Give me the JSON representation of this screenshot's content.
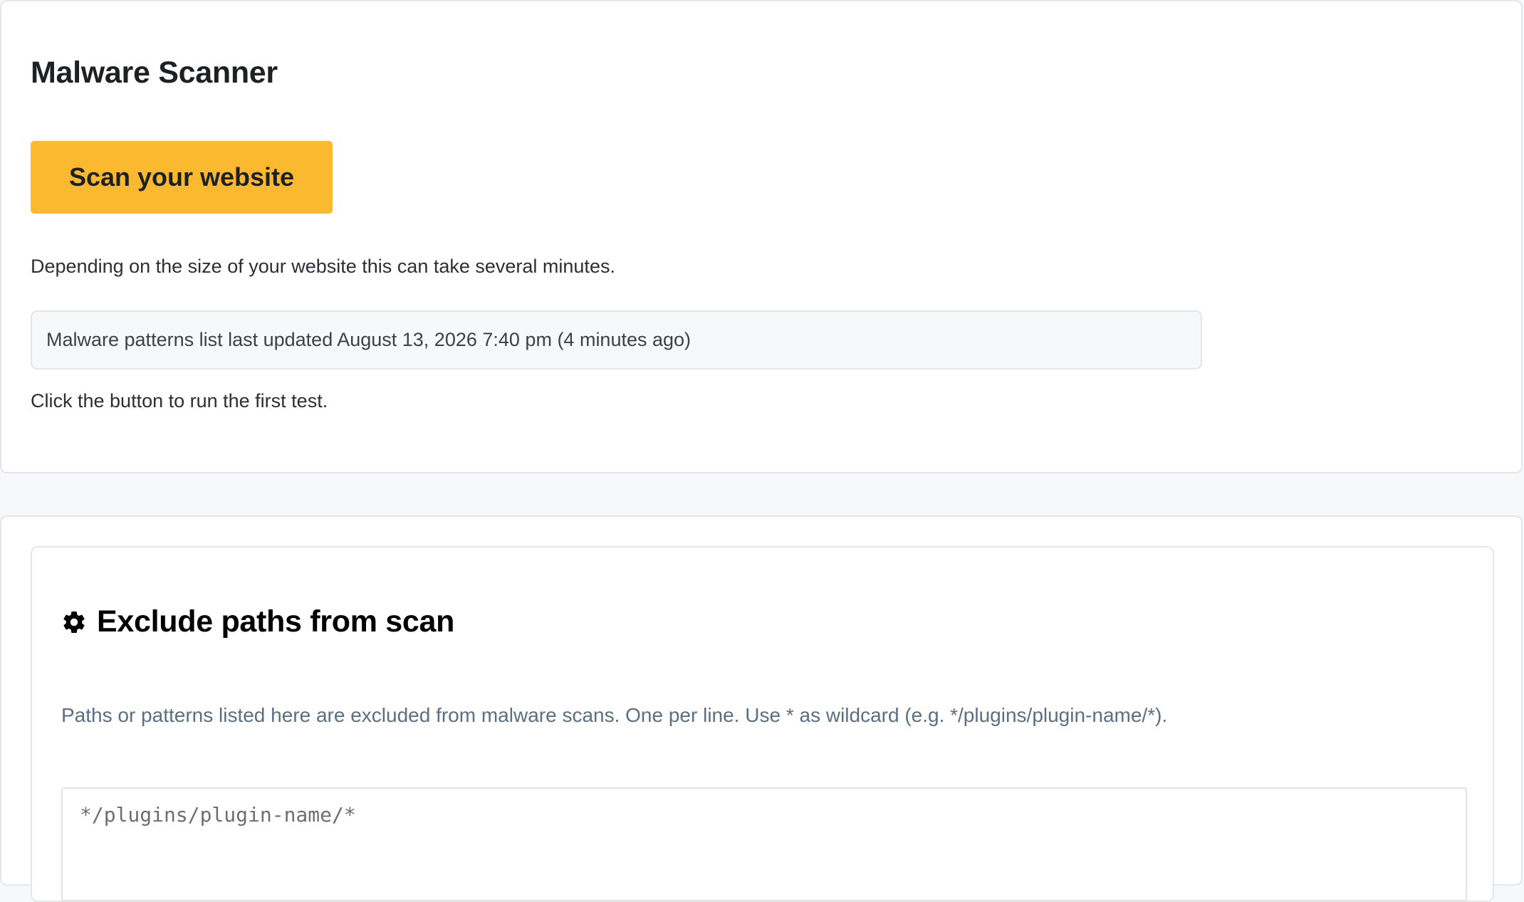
{
  "scanner": {
    "title": "Malware Scanner",
    "scan_button_label": "Scan your website",
    "hint": "Depending on the size of your website this can take several minutes.",
    "patterns_notice": "Malware patterns list last updated August 13, 2026 7:40 pm (4 minutes ago)",
    "status": "Click the button to run the first test."
  },
  "exclude": {
    "title": "Exclude paths from scan",
    "icon": "gear-icon",
    "description": "Paths or patterns listed here are excluded from malware scans. One per line. Use * as wildcard (e.g. */plugins/plugin-name/*).",
    "placeholder": "*/plugins/plugin-name/*",
    "value": ""
  },
  "colors": {
    "scan_button": "#fbb92f",
    "description_text": "#5a6f84"
  }
}
